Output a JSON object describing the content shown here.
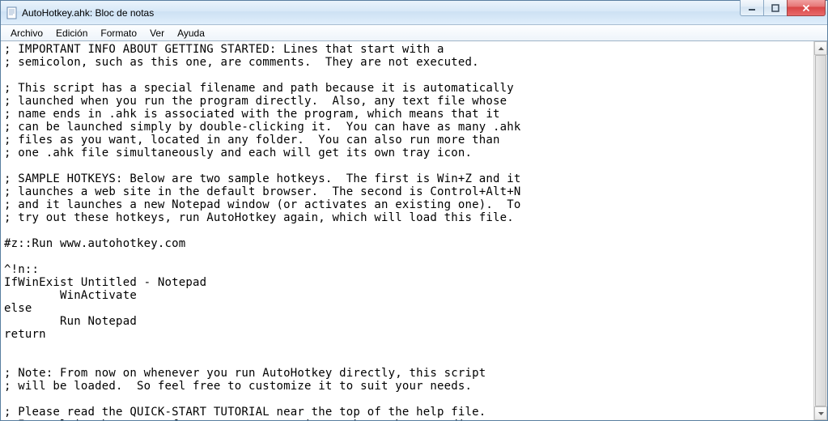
{
  "window": {
    "title": "AutoHotkey.ahk: Bloc de notas"
  },
  "menu": {
    "archivo": "Archivo",
    "edicion": "Edición",
    "formato": "Formato",
    "ver": "Ver",
    "ayuda": "Ayuda"
  },
  "editor": {
    "content": "; IMPORTANT INFO ABOUT GETTING STARTED: Lines that start with a\n; semicolon, such as this one, are comments.  They are not executed.\n\n; This script has a special filename and path because it is automatically\n; launched when you run the program directly.  Also, any text file whose\n; name ends in .ahk is associated with the program, which means that it\n; can be launched simply by double-clicking it.  You can have as many .ahk\n; files as you want, located in any folder.  You can also run more than\n; one .ahk file simultaneously and each will get its own tray icon.\n\n; SAMPLE HOTKEYS: Below are two sample hotkeys.  The first is Win+Z and it\n; launches a web site in the default browser.  The second is Control+Alt+N\n; and it launches a new Notepad window (or activates an existing one).  To\n; try out these hotkeys, run AutoHotkey again, which will load this file.\n\n#z::Run www.autohotkey.com\n\n^!n::\nIfWinExist Untitled - Notepad\n        WinActivate\nelse\n        Run Notepad\nreturn\n\n\n; Note: From now on whenever you run AutoHotkey directly, this script\n; will be loaded.  So feel free to customize it to suit your needs.\n\n; Please read the QUICK-START TUTORIAL near the top of the help file.\n; It explains how to perform common automation tasks such as sending\n; keystrokes and mouse clicks.  It also explains more about hotkeys."
  }
}
